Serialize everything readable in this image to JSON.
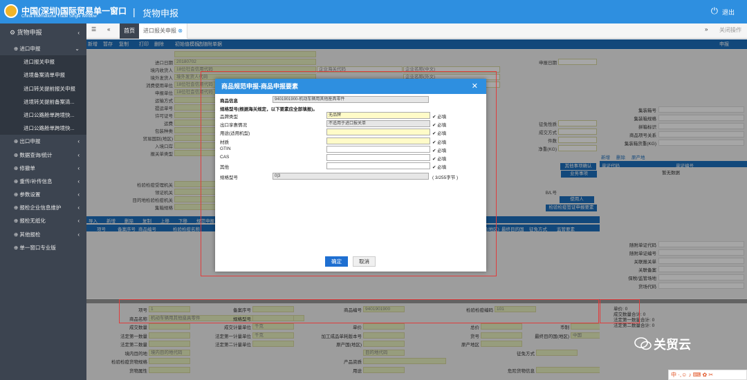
{
  "header": {
    "site_title": "中国(深圳)国际贸易单一窗口",
    "site_subtitle": "China International Trade Single Window",
    "separator": "|",
    "system_title": "货物申报",
    "logout": "退出"
  },
  "sidebar": {
    "root": "货物申报",
    "items": [
      {
        "label": "进口申报",
        "open": true
      },
      {
        "label": "进口报关申报",
        "sub": true
      },
      {
        "label": "进境备案清单申报",
        "sub": true
      },
      {
        "label": "进口转关提前报关申报",
        "sub": true
      },
      {
        "label": "进境转关提前备案清...",
        "sub": true
      },
      {
        "label": "进口公路舱单跨境快...",
        "sub": true
      },
      {
        "label": "进口公路舱单跨境快...",
        "sub": true
      },
      {
        "label": "出口申报"
      },
      {
        "label": "数据查询/统计"
      },
      {
        "label": "修撤单"
      },
      {
        "label": "重传/补传信息"
      },
      {
        "label": "参数设置"
      },
      {
        "label": "报检企业信息维护"
      },
      {
        "label": "报检无纸化"
      },
      {
        "label": "其他报检"
      },
      {
        "label": "单一窗口专业版"
      }
    ]
  },
  "tabs": {
    "home": "首页",
    "active": "进口报关申报",
    "close_ops": "关闭操作"
  },
  "toolbar": [
    "新增",
    "暂存",
    "复制",
    "打印",
    "删除",
    "初始值模板",
    "选随附单据"
  ],
  "toolbar_right": "申报",
  "form": {
    "rows": [
      {
        "label": "",
        "value": ""
      },
      {
        "label": "进口日期",
        "value": "20180702"
      },
      {
        "label": "境内收货人",
        "value": "18位社会信用代码",
        "extra": "企业海关代码",
        "extra2": "企业名称(中文)"
      },
      {
        "label": "境外发货人",
        "value": "境外发货人代码",
        "extra2": "企业名称(外文)"
      },
      {
        "label": "消费使用单位",
        "value": "18位社会信用代码",
        "extra2": "企业名称(中文)"
      },
      {
        "label": "申报单位",
        "value": "18位社会信用代码"
      },
      {
        "label": "运输方式",
        "value": ""
      },
      {
        "label": "提运单号",
        "value": ""
      },
      {
        "label": "许可证号",
        "value": ""
      },
      {
        "label": "运费",
        "value": ""
      },
      {
        "label": "包装种类",
        "value": ""
      },
      {
        "label": "贸易国别(地区)",
        "value": ""
      },
      {
        "label": "入境口岸",
        "value": ""
      },
      {
        "label": "报关单类型",
        "value": ""
      }
    ],
    "right_labels": [
      "申报日期",
      "征免性质",
      "成交方式",
      "件数",
      "净重(KG)"
    ],
    "inspect": [
      "检验检疫受理机关",
      "领证机关",
      "目的地检验检疫机关",
      "集箱规格"
    ],
    "inspect_right": [
      "B/L号",
      "使用人",
      "检验检疫签证申报要素"
    ],
    "bl_btns": [
      "其他事项确认",
      "业务事项"
    ],
    "goods_toolbar": [
      "导入",
      "新增",
      "删除",
      "复制",
      "上移",
      "下移",
      "规范申报"
    ],
    "goods_headers": [
      "项号",
      "备案序号",
      "商品编号",
      "检验检疫名称",
      "原产国(地区)",
      "最终目的国",
      "征免方式",
      "监管要素"
    ]
  },
  "right_panel": {
    "labels": [
      "集装箱号",
      "集装箱规格",
      "拼箱标识",
      "商品项号关系",
      "集装箱货重(KG)"
    ],
    "btns": [
      "新增",
      "删除",
      "原产地"
    ],
    "table_headers": [
      "单证代码",
      "单证编号"
    ],
    "empty": "暂无数据",
    "labels2": [
      "随附单证代码",
      "随附单证编号",
      "关联报关单",
      "关联备案",
      "保税/监管场地",
      "货场代码"
    ]
  },
  "bottom": {
    "rows": [
      [
        {
          "l": "项号",
          "v": "1"
        },
        {
          "l": "备案序号",
          "v": ""
        },
        {
          "l": "商品编号",
          "v": "9401901900"
        },
        {
          "l": "检验检疫编码",
          "v": "101"
        }
      ],
      [
        {
          "l": "商品名称",
          "v": "机动车辆用其他座具零件"
        },
        {
          "l": "规格型号",
          "v": ""
        }
      ],
      [
        {
          "l": "成交数量",
          "v": ""
        },
        {
          "l": "成交计量单位",
          "v": "千克"
        },
        {
          "l": "单价",
          "v": ""
        },
        {
          "l": "总价",
          "v": ""
        },
        {
          "l": "币制",
          "v": ""
        }
      ],
      [
        {
          "l": "法定第一数量",
          "v": ""
        },
        {
          "l": "法定第一计量单位",
          "v": "千克"
        },
        {
          "l": "加工成品单耗版本号",
          "v": ""
        },
        {
          "l": "货号",
          "v": ""
        },
        {
          "l": "最终目的国(地区)",
          "v": "中国"
        }
      ],
      [
        {
          "l": "法定第二数量",
          "v": ""
        },
        {
          "l": "法定第二计量单位",
          "v": ""
        },
        {
          "l": "原产国(地区)",
          "v": ""
        },
        {
          "l": "原产地区",
          "v": ""
        }
      ],
      [
        {
          "l": "境内目的地",
          "v": "境内目的地代码"
        },
        {
          "l": "",
          "v": "目的地代码"
        },
        {
          "l": "征免方式",
          "v": ""
        }
      ],
      [
        {
          "l": "检验检疫货物规格",
          "v": ""
        },
        {
          "l": "产品资质",
          "v": ""
        }
      ],
      [
        {
          "l": "货物属性",
          "v": ""
        },
        {
          "l": "用途",
          "v": ""
        },
        {
          "l": "危险货物信息",
          "v": ""
        }
      ]
    ]
  },
  "summary": [
    "单价: 0",
    "成交数量合计: 0",
    "法定第一数量合计: 0",
    "法定第二数量合计: 0"
  ],
  "dialog": {
    "title": "商品规范申报-商品申报要素",
    "goods_info_label": "商品信息",
    "goods_info_value": "9401901900-机动车辆用其他座具零件",
    "hint": "规格型号(根据海关规定，以下要素应全部填报)。",
    "fields": [
      {
        "label": "品牌类型",
        "value": "无品牌",
        "style": "y",
        "check": "必填"
      },
      {
        "label": "出口享惠情况",
        "value": "不适用于进口报关单",
        "style": "g",
        "check": "必填"
      },
      {
        "label": "用途(适用机型)",
        "value": "",
        "style": "y",
        "check": "必填"
      },
      {
        "label": "材质",
        "value": "",
        "style": "y",
        "check": "必填"
      },
      {
        "label": "GTIN",
        "value": "",
        "style": "w",
        "check": "必填"
      },
      {
        "label": "CAS",
        "value": "",
        "style": "w",
        "check": "必填"
      },
      {
        "label": "其他",
        "value": "",
        "style": "w",
        "check": "必填"
      }
    ],
    "spec_label": "规格型号",
    "spec_value": "0|3",
    "spec_count": "( 3/255字节 )",
    "ok": "确定",
    "cancel": "取消"
  },
  "watermark": "关贸云",
  "ime": "中"
}
